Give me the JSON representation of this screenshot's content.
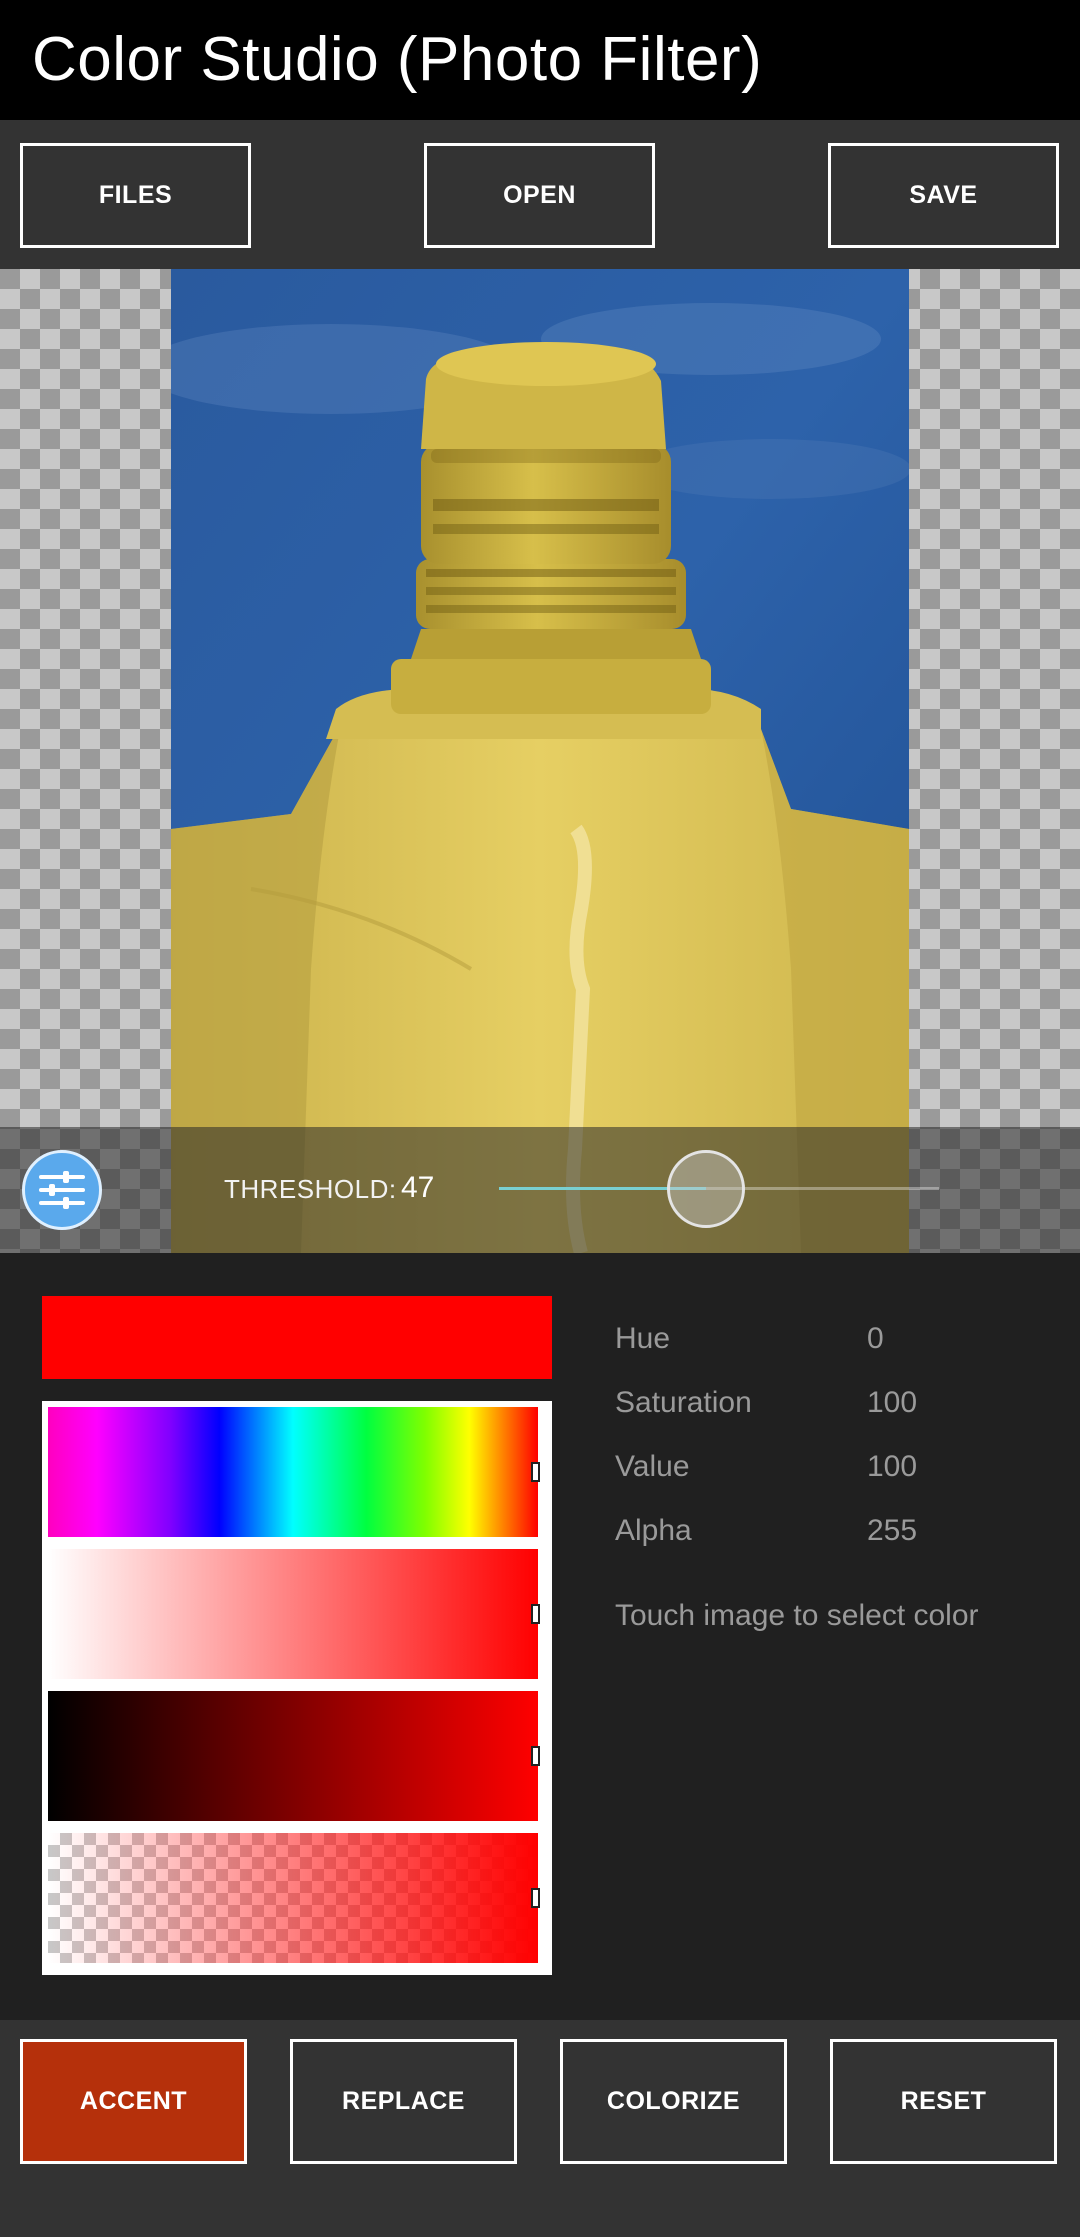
{
  "app": {
    "title": "Color Studio (Photo Filter)"
  },
  "toolbar": {
    "files_label": "FILES",
    "open_label": "OPEN",
    "save_label": "SAVE"
  },
  "threshold": {
    "label": "THRESHOLD:",
    "value": "47",
    "fraction": 0.47
  },
  "picker": {
    "swatch_color": "#ff0000",
    "hue_label": "Hue",
    "hue_value": "0",
    "saturation_label": "Saturation",
    "saturation_value": "100",
    "value_label": "Value",
    "value_value": "100",
    "alpha_label": "Alpha",
    "alpha_value": "255",
    "hint": "Touch image to select color"
  },
  "modes": {
    "accent_label": "ACCENT",
    "replace_label": "REPLACE",
    "colorize_label": "COLORIZE",
    "reset_label": "RESET",
    "active": "accent",
    "active_color": "#b5300b"
  },
  "icons": {
    "threshold_toggle": "sliders-icon"
  }
}
